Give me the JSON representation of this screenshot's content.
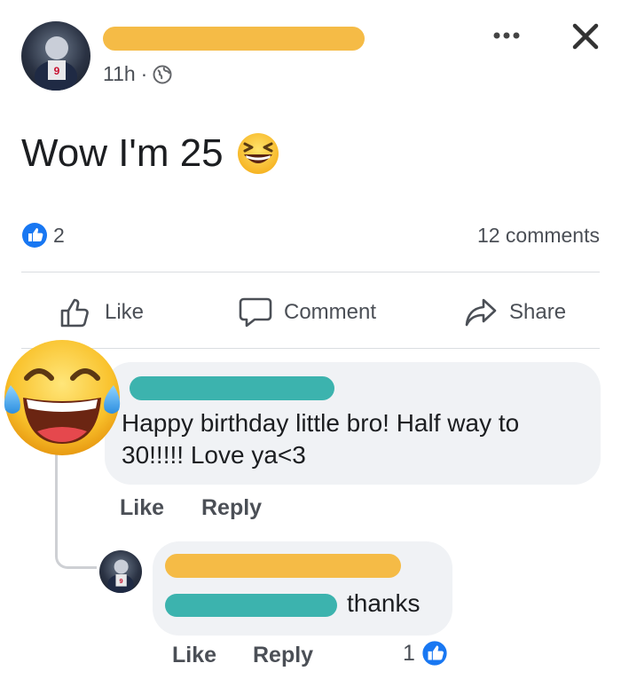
{
  "post": {
    "time": "11h",
    "text": "Wow I'm 25",
    "reaction_count": "2",
    "comments_count": "12 comments",
    "colors": {
      "name_redaction": "#f5bb46",
      "like_blue": "#1877f2"
    }
  },
  "header_icons": {
    "more": "more-icon",
    "close": "close-icon",
    "privacy": "globe-icon"
  },
  "actions": {
    "like": "Like",
    "comment": "Comment",
    "share": "Share"
  },
  "comment1": {
    "text_line1": "Happy birthday little bro! Half way to",
    "text_line2": "30!!!!! Love ya<3",
    "like": "Like",
    "reply": "Reply",
    "name_redaction_color": "#3cb3ae"
  },
  "reply1": {
    "text": "thanks",
    "like": "Like",
    "reply": "Reply",
    "reaction_count": "1",
    "name_redaction_color": "#f5bb46",
    "mention_redaction_color": "#3cb3ae"
  }
}
